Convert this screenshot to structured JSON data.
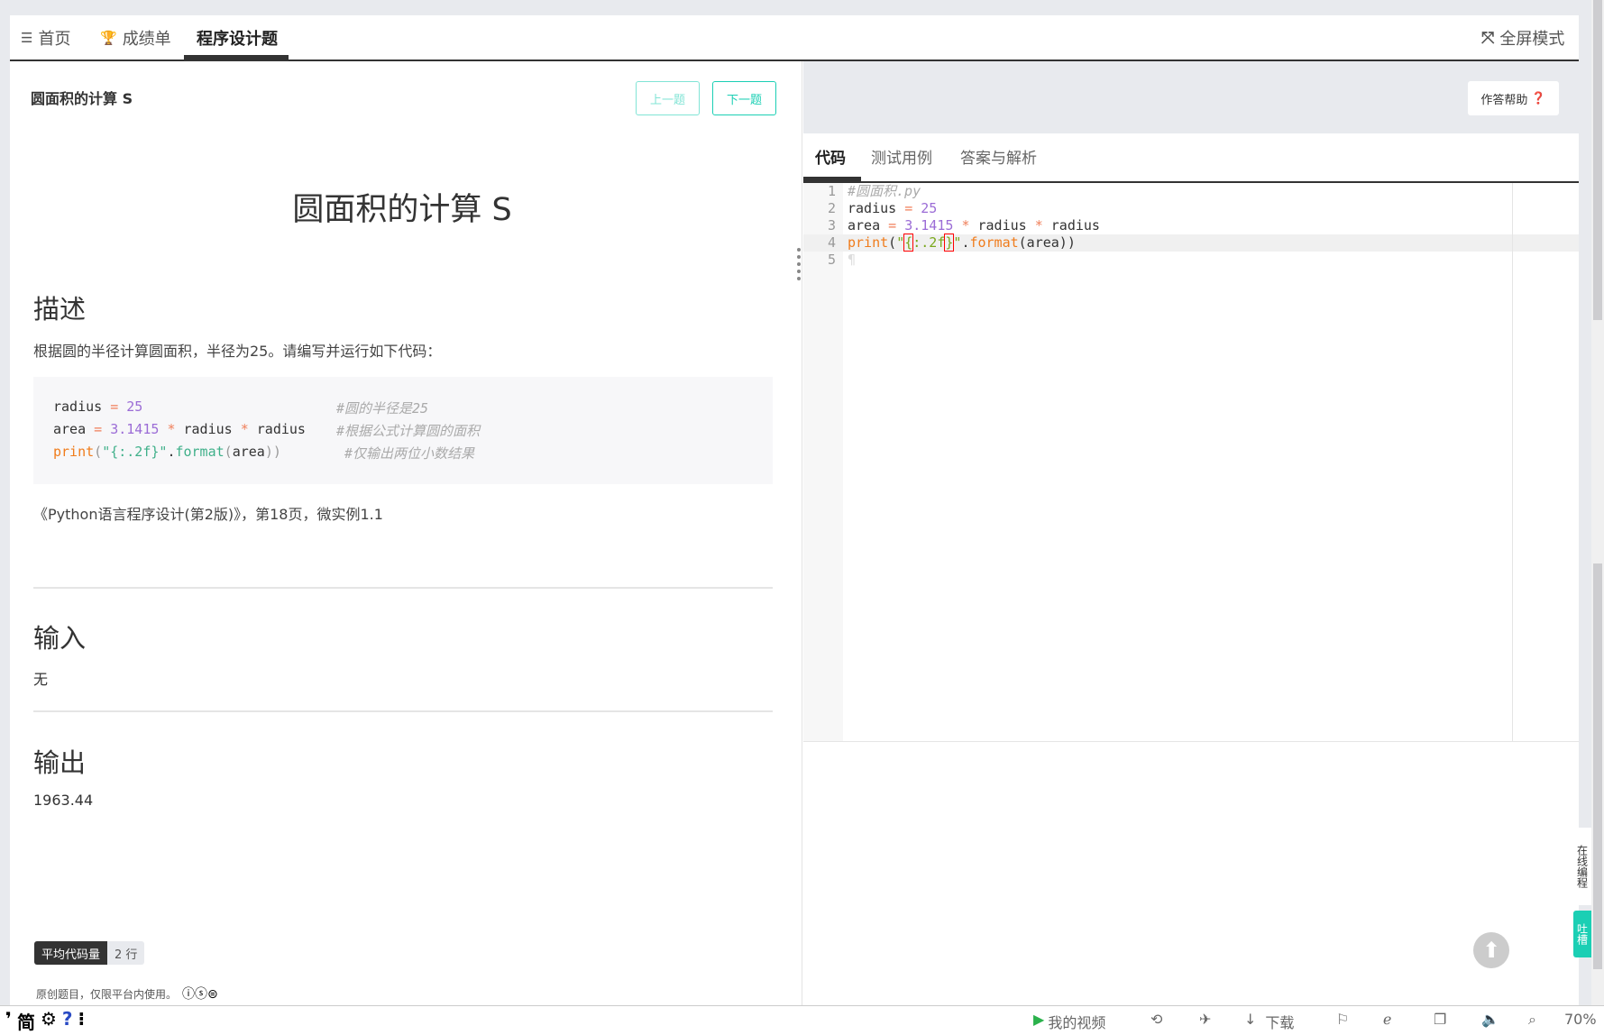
{
  "nav": {
    "tabs": [
      {
        "label": "首页",
        "icon": "list-icon"
      },
      {
        "label": "成绩单",
        "icon": "trophy-icon"
      },
      {
        "label": "程序设计题",
        "active": true
      }
    ],
    "fullscreen": "全屏模式"
  },
  "problem": {
    "header_title": "圆面积的计算 S",
    "prev": "上一题",
    "next": "下一题",
    "title": "圆面积的计算 S",
    "desc_heading": "描述",
    "desc_text": "根据圆的半径计算圆面积，半径为25。请编写并运行如下代码：",
    "sample": [
      {
        "code": "radius = 25",
        "comment": "#圆的半径是25"
      },
      {
        "code": "area = 3.1415 * radius * radius",
        "comment": "#根据公式计算圆的面积"
      },
      {
        "code": "print(\"{:.2f}\".format(area))",
        "comment": " #仅输出两位小数结果"
      }
    ],
    "reference": "《Python语言程序设计(第2版)》，第18页，微实例1.1",
    "input_heading": "输入",
    "input_text": "无",
    "output_heading": "输出",
    "output_text": "1963.44",
    "avg_label": "平均代码量",
    "avg_value": "2 行",
    "footer": "原创题目，仅限平台内使用。"
  },
  "editor": {
    "help": "作答帮助",
    "tabs": [
      "代码",
      "测试用例",
      "答案与解析"
    ],
    "lines": [
      {
        "n": "1",
        "text": "#圆面积.py"
      },
      {
        "n": "2",
        "text": "radius = 25"
      },
      {
        "n": "3",
        "text": "area = 3.1415 * radius * radius"
      },
      {
        "n": "4",
        "text": "print(\"{:.2f}\".format(area))"
      },
      {
        "n": "5",
        "text": ""
      }
    ]
  },
  "side": {
    "online": "在线编程",
    "feedback": "吐槽"
  },
  "statusbar": {
    "left": "简",
    "video": "我的视频",
    "download": "下载",
    "zoom": "70%"
  },
  "colors": {
    "accent": "#1bcfb4",
    "dark": "#333333",
    "bg": "#e8eaee"
  }
}
